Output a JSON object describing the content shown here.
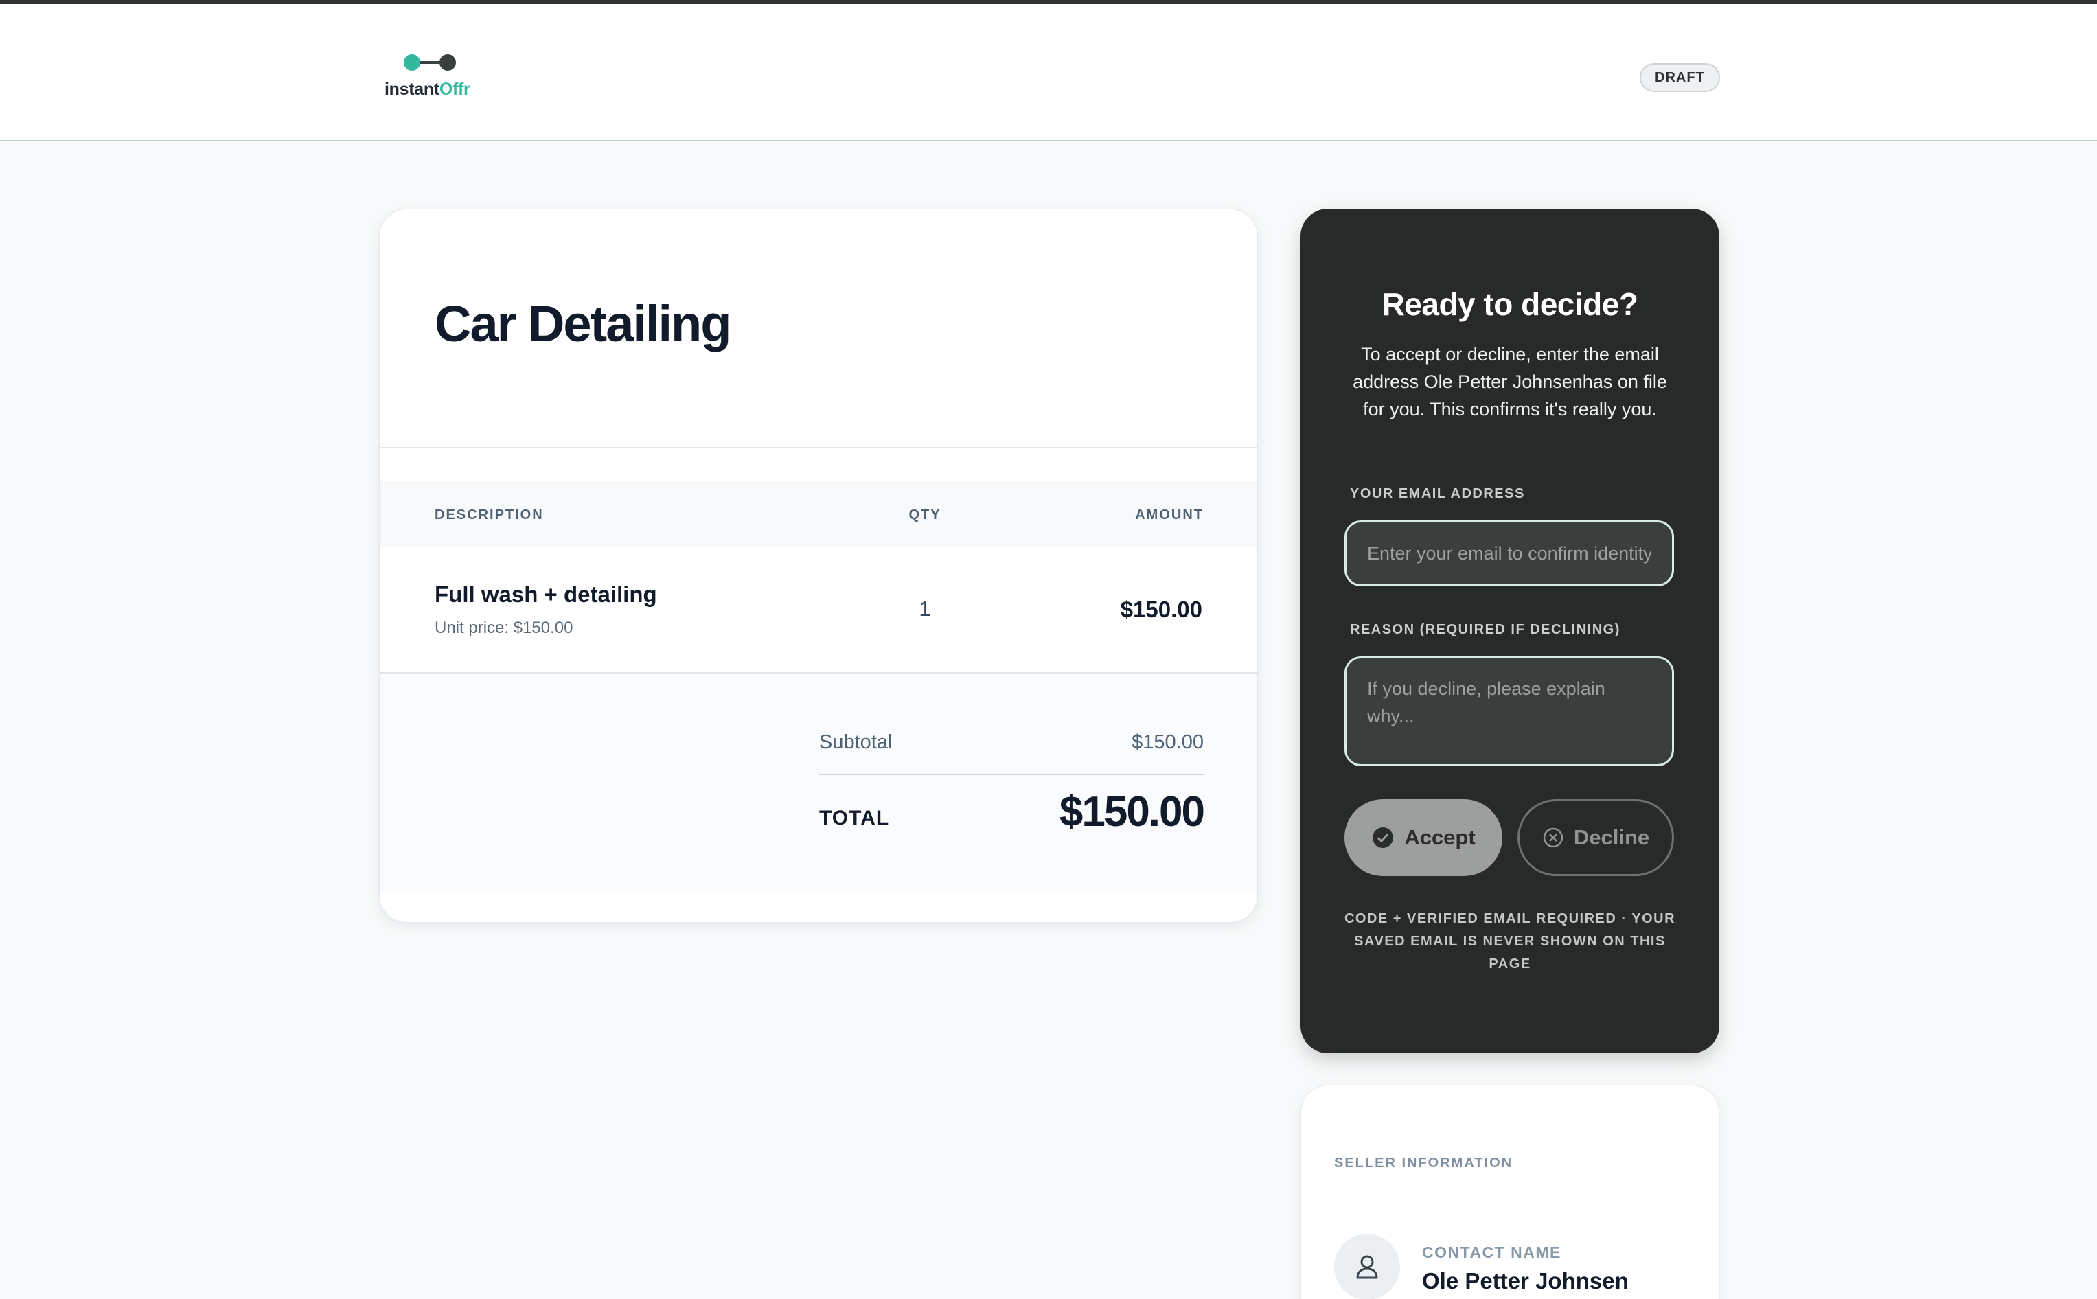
{
  "header": {
    "logo_text_part1": "instant",
    "logo_text_part2": "Offr",
    "status_badge": "DRAFT"
  },
  "offer": {
    "title": "Car Detailing",
    "columns": {
      "description": "DESCRIPTION",
      "qty": "QTY",
      "amount": "AMOUNT"
    },
    "items": [
      {
        "name": "Full wash + detailing",
        "unit_price": "Unit price: $150.00",
        "qty": "1",
        "amount": "$150.00"
      }
    ],
    "subtotal_label": "Subtotal",
    "subtotal_value": "$150.00",
    "total_label": "TOTAL",
    "total_value": "$150.00"
  },
  "decision": {
    "title": "Ready to decide?",
    "description": "To accept or decline, enter the email address Ole Petter Johnsenhas on file for you. This confirms it's really you.",
    "email_label": "YOUR EMAIL ADDRESS",
    "email_placeholder": "Enter your email to confirm identity",
    "reason_label": "REASON (REQUIRED IF DECLINING)",
    "reason_placeholder": "If you decline, please explain why...",
    "accept_label": "Accept",
    "decline_label": "Decline",
    "note": "CODE + VERIFIED EMAIL REQUIRED · YOUR SAVED EMAIL IS NEVER SHOWN ON THIS PAGE"
  },
  "seller": {
    "section_title": "SELLER INFORMATION",
    "contact_label": "CONTACT NAME",
    "contact_name": "Ole Petter Johnsen"
  },
  "colors": {
    "brand_teal": "#35b8a0",
    "panel_dark": "#272a29",
    "text_dark": "#111b2b"
  },
  "icons": {
    "logo": "two-connected-dots-icon",
    "accept": "check-circle-icon",
    "decline": "x-circle-icon",
    "avatar": "user-icon"
  }
}
